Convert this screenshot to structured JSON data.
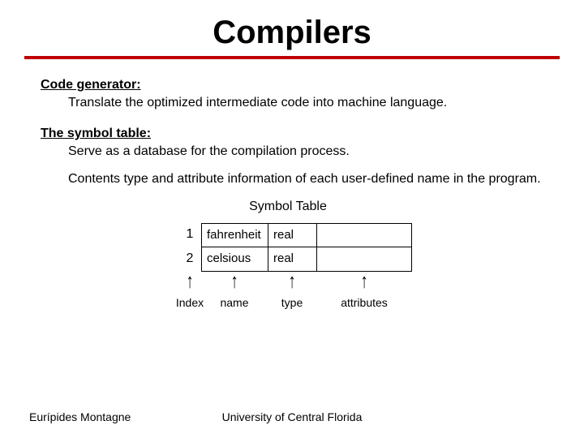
{
  "title": "Compilers",
  "sections": {
    "codegen": {
      "heading": "Code generator:",
      "body": "Translate the optimized intermediate code into machine language."
    },
    "symtab": {
      "heading": "The symbol table:",
      "body1": "Serve as a database for the compilation process.",
      "body2": "Contents type and attribute information of each user-defined name in the program."
    }
  },
  "symbol_table": {
    "caption": "Symbol Table",
    "rows": [
      {
        "index": "1",
        "name": "fahrenheit",
        "type": "real",
        "attributes": ""
      },
      {
        "index": "2",
        "name": "celsious",
        "type": "real",
        "attributes": ""
      }
    ],
    "labels": {
      "index": "Index",
      "name": "name",
      "type": "type",
      "attributes": "attributes"
    }
  },
  "footer": {
    "author": "Eurípides Montagne",
    "org": "University of Central Florida"
  }
}
